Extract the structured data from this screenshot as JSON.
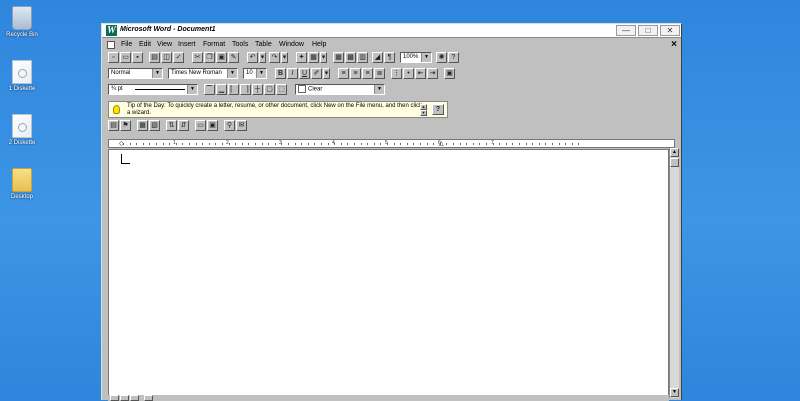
{
  "desktop": {
    "icons": [
      {
        "label": "Recycle Bin",
        "icon": "recycle-bin-icon"
      },
      {
        "label": "1 Diskette",
        "icon": "diskette-icon"
      },
      {
        "label": "2 Diskette",
        "icon": "diskette-icon"
      },
      {
        "label": "Desktop",
        "icon": "folder-icon"
      }
    ]
  },
  "window": {
    "title": "Microsoft Word - Document1",
    "logo_letter": "W",
    "controls": {
      "minimize": "—",
      "maximize": "□",
      "close": "✕"
    },
    "doc_close": "×"
  },
  "menu": [
    "File",
    "Edit",
    "View",
    "Insert",
    "Format",
    "Tools",
    "Table",
    "Window",
    "Help"
  ],
  "toolbar": {
    "zoom": "100%",
    "style": "Normal",
    "font": "Times New Roman",
    "font_size": "10",
    "bold": "B",
    "italic": "I",
    "underline": "U",
    "border_width": "¾ pt",
    "shading": "Clear",
    "help_label": "?"
  },
  "tip": {
    "text": "Tip of the Day: To quickly create a letter, resume, or other document, click New on the File menu, and then click a wizard."
  },
  "ruler": {
    "numbers": [
      "1",
      "2",
      "3",
      "4",
      "5",
      "6",
      "7"
    ]
  },
  "colors": {
    "desktop": "#3a8fe3",
    "window_face": "#c0c0c0",
    "logo": "#0b6b5a"
  }
}
